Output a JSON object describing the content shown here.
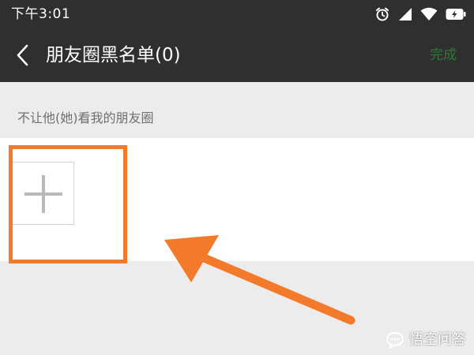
{
  "status_bar": {
    "time": "下午3:01",
    "icons": [
      "alarm-icon",
      "signal-icon",
      "wifi-icon",
      "battery-charging-icon"
    ]
  },
  "nav": {
    "back_icon": "chevron-left-icon",
    "title": "朋友圈黑名单(0)",
    "done_label": "完成"
  },
  "section": {
    "hint": "不让他(她)看我的朋友圈"
  },
  "member_panel": {
    "add_icon": "plus-icon"
  },
  "annotation": {
    "highlight_color": "#f37a2a",
    "arrow_color": "#f37a2a"
  },
  "watermark": {
    "icon": "speech-bubble-icon",
    "text": "悟空问答"
  },
  "colors": {
    "header_bg": "#2f2f2f",
    "done_text": "#2f7a35",
    "page_bg": "#ececec",
    "hint_text": "#6f6f6f"
  }
}
